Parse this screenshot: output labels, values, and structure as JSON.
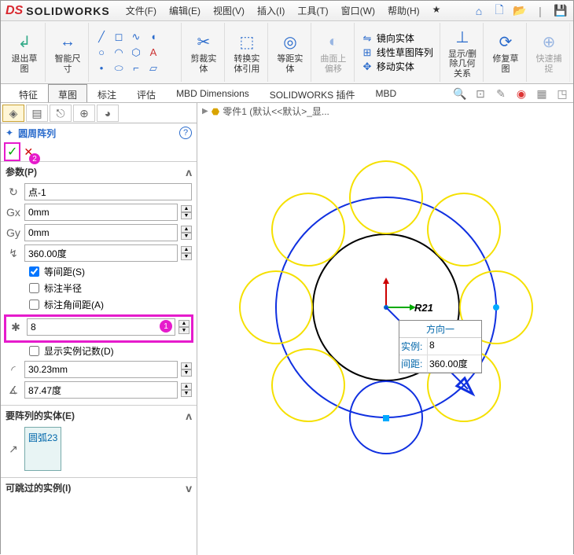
{
  "app": {
    "logo": "SOLIDWORKS"
  },
  "menu": {
    "file": "文件(F)",
    "edit": "编辑(E)",
    "view": "视图(V)",
    "insert": "插入(I)",
    "tools": "工具(T)",
    "window": "窗口(W)",
    "help": "帮助(H)"
  },
  "ribbon": {
    "exit_sketch": "退出草图",
    "smart_dim": "智能尺寸",
    "trim": "剪裁实体",
    "convert": "转换实体引用",
    "offset": "等距实体",
    "on_surface": "曲面上偏移",
    "mirror": "镜向实体",
    "linear_pattern": "线性草图阵列",
    "move": "移动实体",
    "show_rel": "显示/删除几何关系",
    "repair": "修复草图",
    "quick_snap": "快速捕捉"
  },
  "tabs": {
    "feature": "特征",
    "sketch": "草图",
    "annotate": "标注",
    "evaluate": "评估",
    "mbd": "MBD Dimensions",
    "plugin": "SOLIDWORKS 插件",
    "mbd2": "MBD"
  },
  "panel": {
    "title": "圆周阵列",
    "params_hdr": "参数(P)",
    "center": "点-1",
    "x": "0mm",
    "y": "0mm",
    "angle": "360.00度",
    "equal_spacing": "等间距(S)",
    "mark_radius": "标注半径",
    "mark_angle": "标注角间距(A)",
    "count": "8",
    "show_inst": "显示实例记数(D)",
    "radius": "30.23mm",
    "arc_ang": "87.47度",
    "entities_hdr": "要阵列的实体(E)",
    "entity": "圆弧23",
    "skip_hdr": "可跳过的实例(I)"
  },
  "crumb": "零件1  (默认<<默认>_显...",
  "dim": {
    "hdr": "方向一",
    "inst_lbl": "实例:",
    "inst_val": "8",
    "gap_lbl": "间距:",
    "gap_val": "360.00度",
    "r": "R21"
  }
}
